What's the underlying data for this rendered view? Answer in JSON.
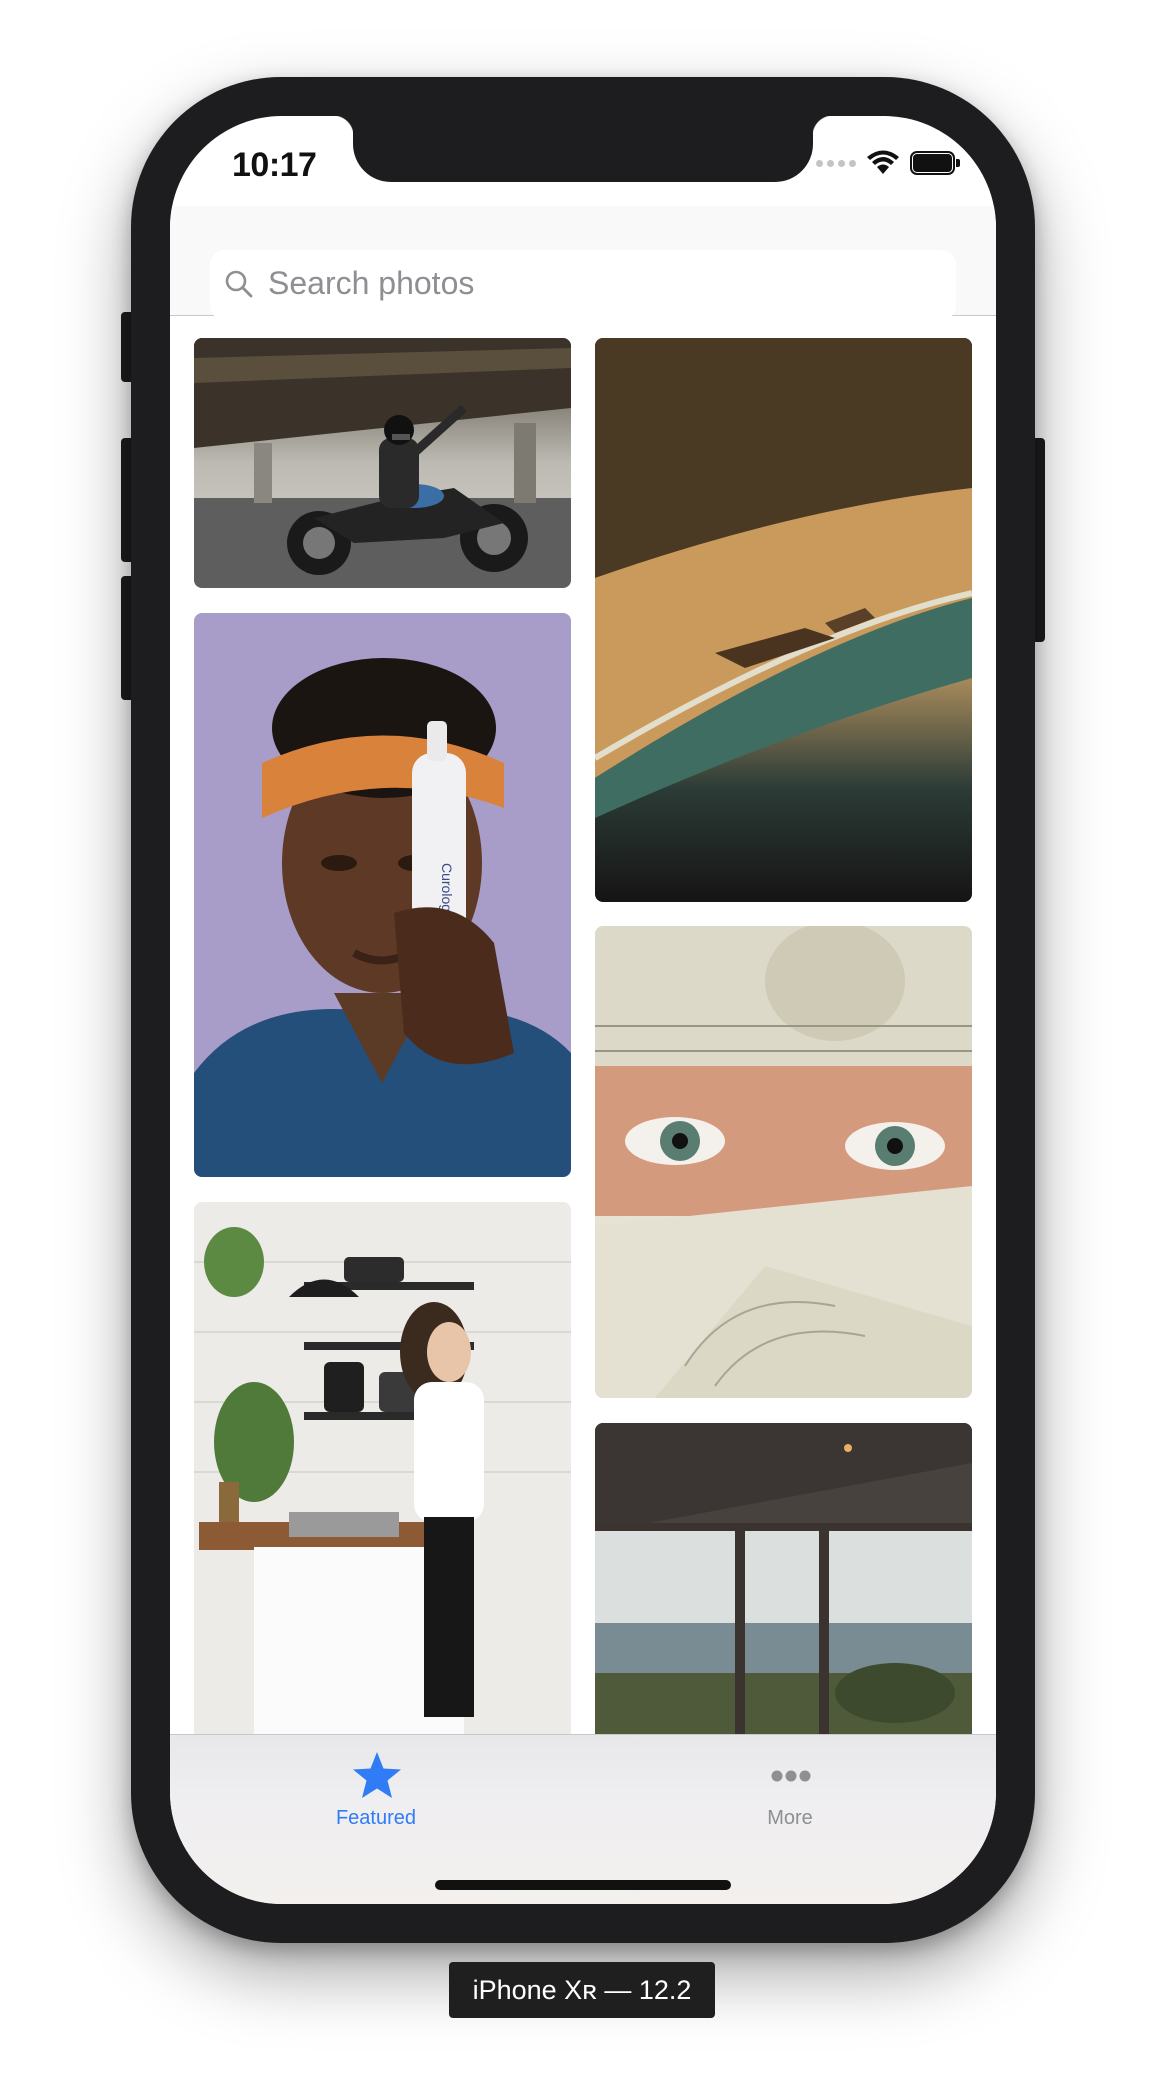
{
  "status_bar": {
    "time": "10:17"
  },
  "search": {
    "placeholder": "Search photos"
  },
  "photos": [
    {
      "subject": "motorcyclist under bridge"
    },
    {
      "subject": "man with orange headband holding bottle"
    },
    {
      "subject": "woman washing dishes in kitchen"
    },
    {
      "subject": "aerial beach with shipwreck"
    },
    {
      "subject": "eyes between dollar bills"
    },
    {
      "subject": "city view through windows"
    }
  ],
  "tabs": [
    {
      "label": "Featured",
      "icon": "star-icon",
      "selected": true
    },
    {
      "label": "More",
      "icon": "more-icon",
      "selected": false
    }
  ],
  "device": {
    "caption": "iPhone Xʀ — 12.2"
  },
  "colors": {
    "accent": "#2f7cf6",
    "inactive": "#8e8e93"
  }
}
